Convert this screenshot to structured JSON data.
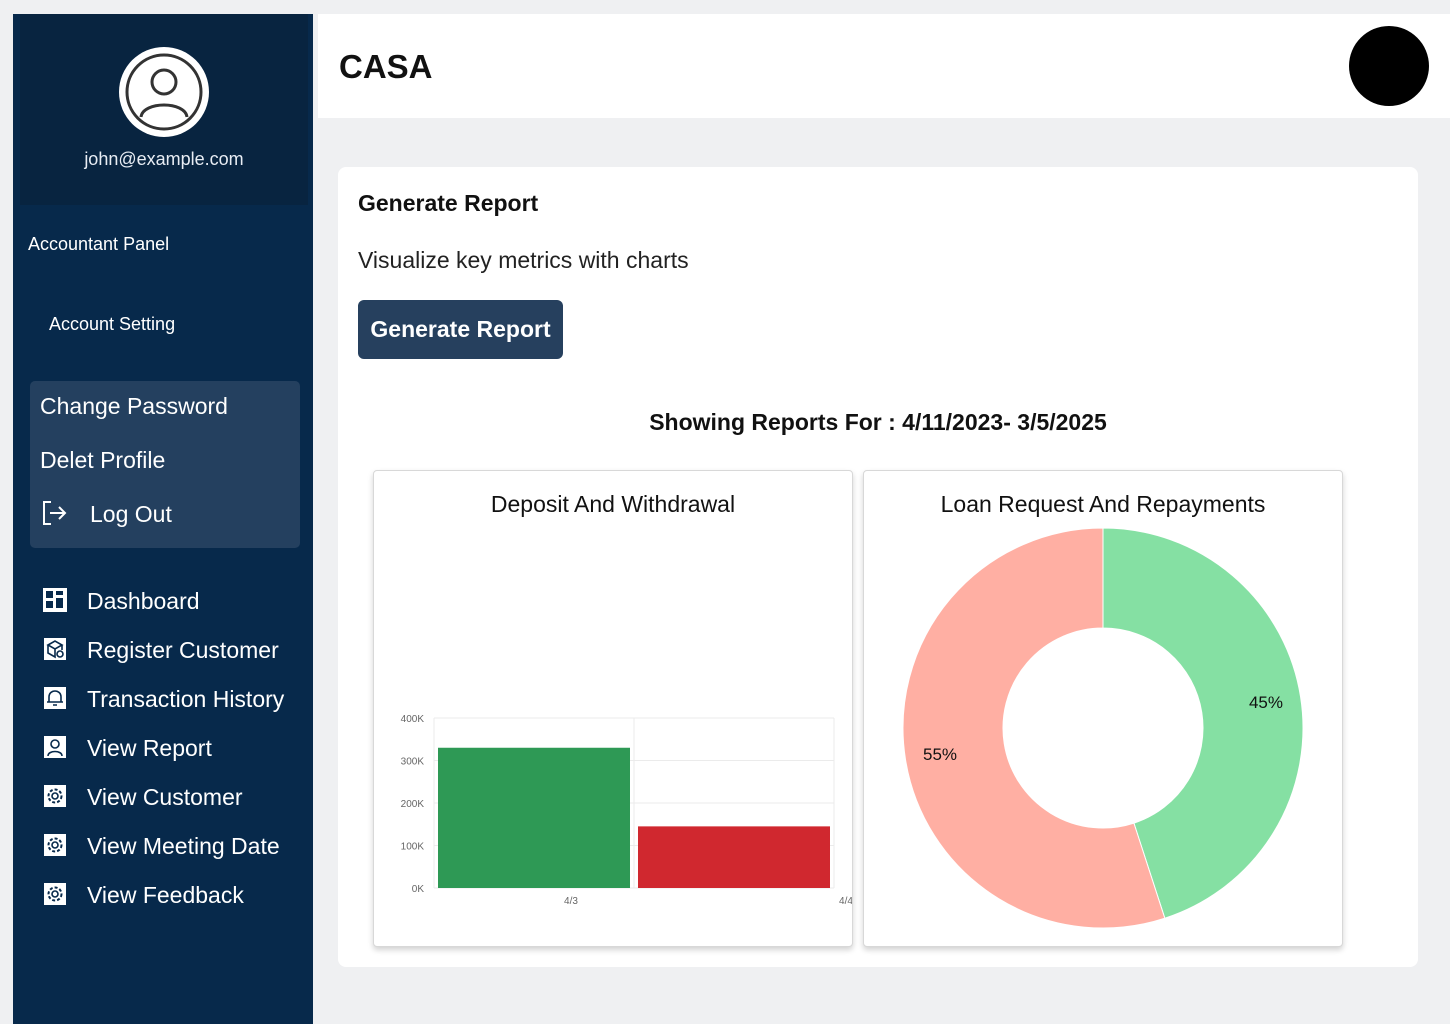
{
  "sidebar": {
    "email": "john@example.com",
    "panel_title": "Accountant Panel",
    "account_setting": "Account Setting",
    "submenu": {
      "change_password": "Change Password",
      "delete_profile": "Delet Profile",
      "log_out": "Log Out"
    },
    "nav": [
      {
        "label": "Dashboard",
        "icon": "dashboard-icon"
      },
      {
        "label": "Register Customer",
        "icon": "register-customer-icon"
      },
      {
        "label": "Transaction History",
        "icon": "bell-icon"
      },
      {
        "label": "View Report",
        "icon": "user-icon"
      },
      {
        "label": "View Customer",
        "icon": "gear-icon"
      },
      {
        "label": "View Meeting Date",
        "icon": "gear-icon"
      },
      {
        "label": "View Feedback",
        "icon": "gear-icon"
      }
    ]
  },
  "header": {
    "title": "CASA"
  },
  "report": {
    "title": "Generate Report",
    "subtitle": "Visualize key metrics with charts",
    "button_label": "Generate Report",
    "showing_for": "Showing Reports For : 4/11/2023- 3/5/2025"
  },
  "colors": {
    "sidebar_bg": "#07294b",
    "button_bg": "#26405e",
    "deposit": "#2e9955",
    "withdrawal": "#d0282f",
    "loan_request": "#ffafa3",
    "repayment": "#85e0a3"
  },
  "chart_data": [
    {
      "type": "bar",
      "title": "Deposit And Withdrawal",
      "x": [
        "4/3",
        "4/4"
      ],
      "series": [
        {
          "values": [
            330000
          ],
          "color": "#2e9955"
        },
        {
          "values": [
            145000
          ],
          "color": "#d0282f"
        }
      ],
      "ylim": [
        0,
        400000
      ],
      "yticks": [
        "0K",
        "100K",
        "200K",
        "300K",
        "400K"
      ],
      "grid": true
    },
    {
      "type": "pie",
      "title": "Loan Request And Repayments",
      "slices": [
        {
          "label": "45%",
          "value": 45,
          "color": "#85e0a3"
        },
        {
          "label": "55%",
          "value": 55,
          "color": "#ffafa3"
        }
      ],
      "donut": true
    }
  ]
}
